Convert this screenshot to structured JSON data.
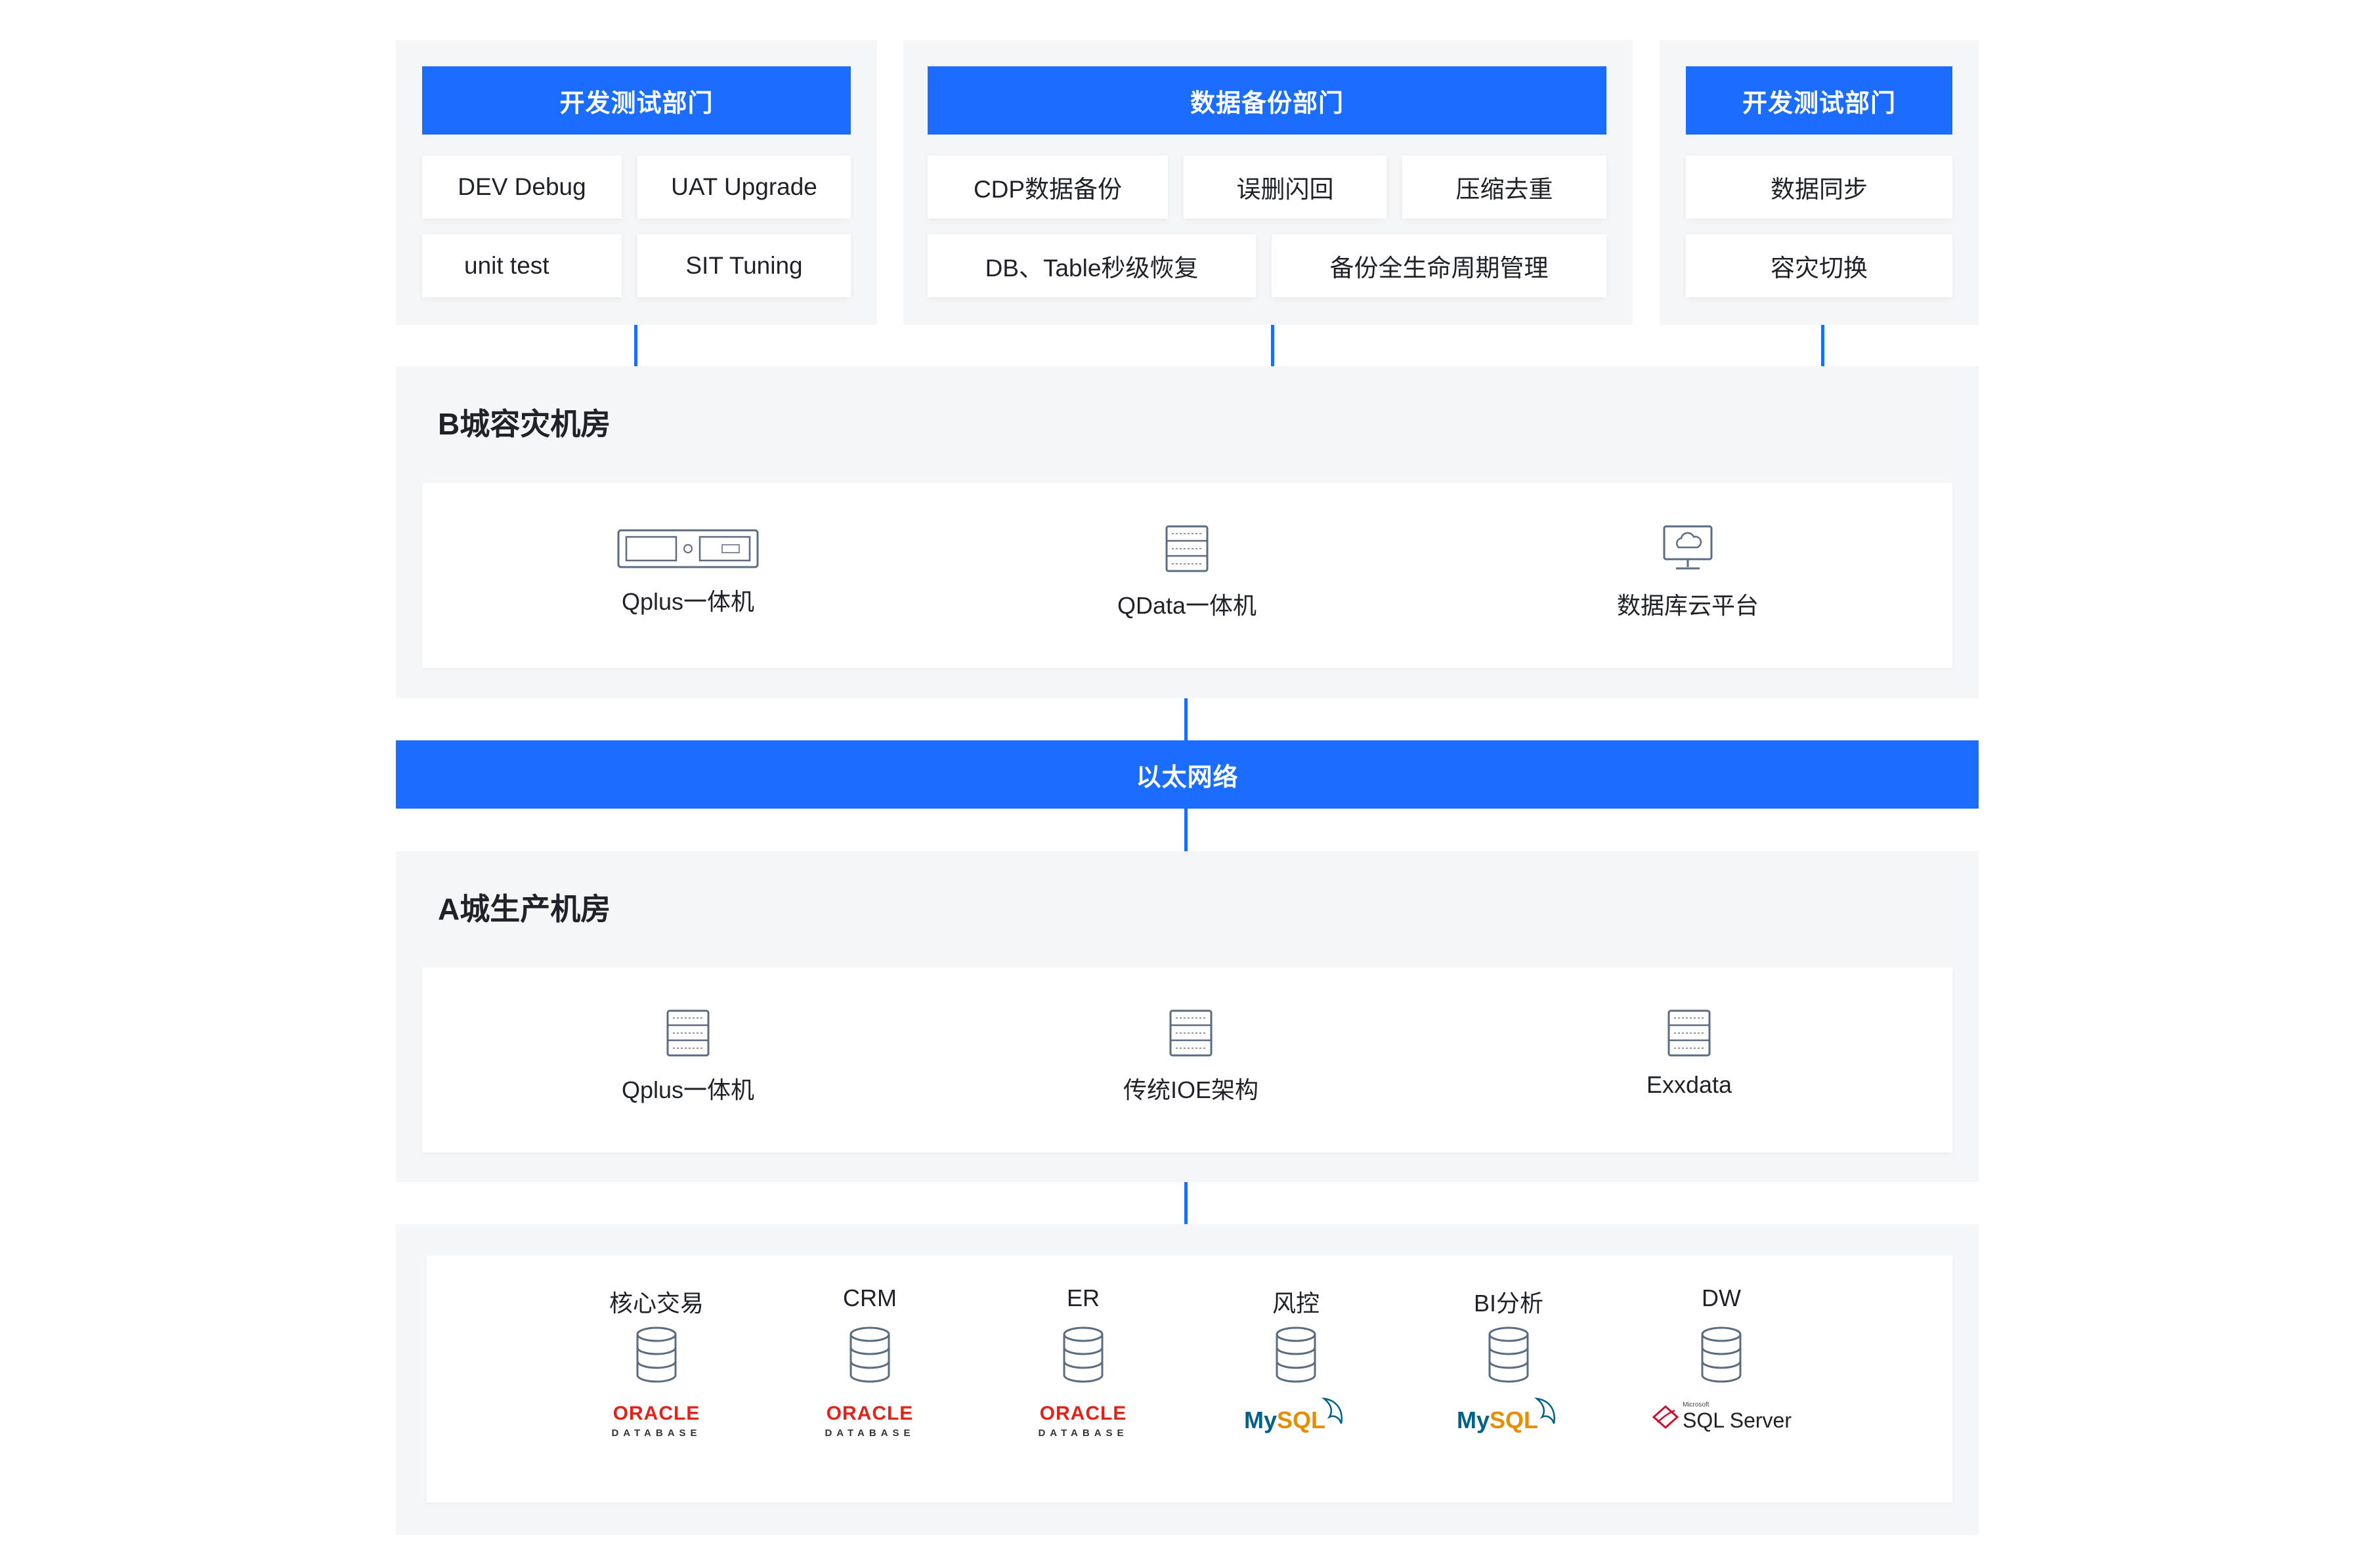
{
  "departments": [
    {
      "header": "开发测试部门",
      "items": [
        "DEV Debug",
        "UAT Upgrade",
        "unit test",
        "SIT Tuning"
      ]
    },
    {
      "header": "数据备份部门",
      "items": [
        "CDP数据备份",
        "误删闪回",
        "压缩去重",
        "DB、Table秒级恢复",
        "备份全生命周期管理"
      ]
    },
    {
      "header": "开发测试部门",
      "items": [
        "数据同步",
        "容灾切换"
      ]
    }
  ],
  "room_b": {
    "title": "B城容灾机房",
    "nodes": [
      {
        "label": "Qplus一体机",
        "icon": "appliance-icon"
      },
      {
        "label": "QData一体机",
        "icon": "server-icon"
      },
      {
        "label": "数据库云平台",
        "icon": "cloud-monitor-icon"
      }
    ]
  },
  "network": {
    "label": "以太网络"
  },
  "room_a": {
    "title": "A城生产机房",
    "nodes": [
      {
        "label": "Qplus一体机",
        "icon": "server-icon"
      },
      {
        "label": "传统IOE架构",
        "icon": "server-icon"
      },
      {
        "label": "Exxdata",
        "icon": "server-icon"
      }
    ]
  },
  "databases": [
    {
      "label": "核心交易",
      "logo": "oracle"
    },
    {
      "label": "CRM",
      "logo": "oracle"
    },
    {
      "label": "ER",
      "logo": "oracle"
    },
    {
      "label": "风控",
      "logo": "mysql"
    },
    {
      "label": "BI分析",
      "logo": "mysql"
    },
    {
      "label": "DW",
      "logo": "sqlserver"
    }
  ],
  "logos": {
    "oracle_word": "ORACLE",
    "oracle_sub": "DATABASE",
    "mysql_my": "My",
    "mysql_sql": "SQL",
    "sqlserver_ms": "Microsoft",
    "sqlserver_word": "SQL Server"
  },
  "colors": {
    "accent": "#1a6dff",
    "panel": "#f5f6f8",
    "icon": "#5b6b80"
  }
}
